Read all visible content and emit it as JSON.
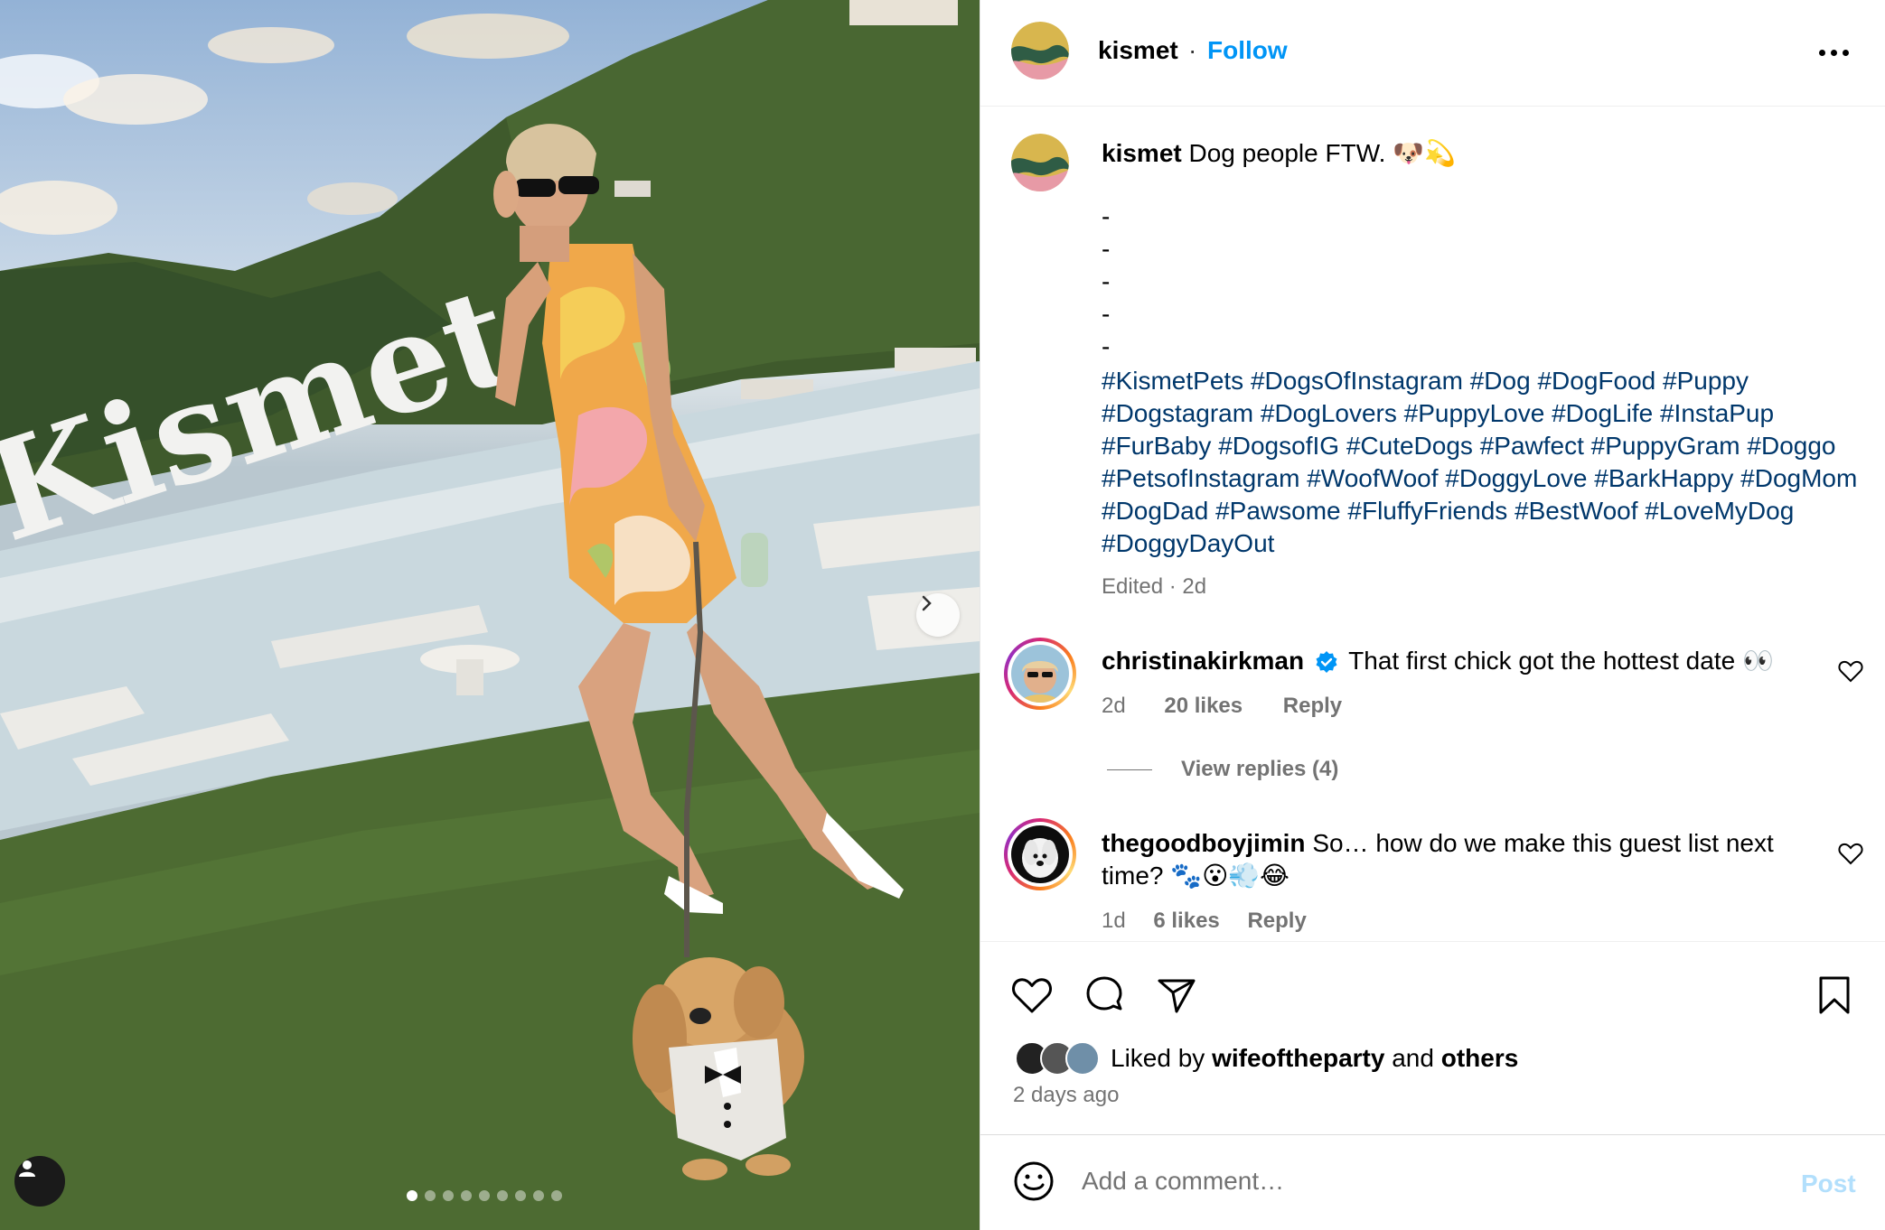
{
  "post": {
    "author": "kismet",
    "follow_label": "Follow",
    "separator": "·",
    "image_sign_text": "Kismet",
    "carousel": {
      "total": 9,
      "active": 1
    }
  },
  "caption": {
    "username": "kismet",
    "text": "Dog people FTW. 🐶💫",
    "dashes": [
      "-",
      "-",
      "-",
      "-",
      "-"
    ],
    "hashtags": [
      "#KismetPets",
      "#DogsOfInstagram",
      "#Dog",
      "#DogFood",
      "#Puppy",
      "#Dogstagram",
      "#DogLovers",
      "#PuppyLove",
      "#DogLife",
      "#InstaPup",
      "#FurBaby",
      "#DogsofIG",
      "#CuteDogs",
      "#Pawfect",
      "#PuppyGram",
      "#Doggo",
      "#PetsofInstagram",
      "#WoofWoof",
      "#DoggyLove",
      "#BarkHappy",
      "#DogMom",
      "#DogDad",
      "#Pawsome",
      "#FluffyFriends",
      "#BestWoof",
      "#LoveMyDog",
      "#DoggyDayOut"
    ],
    "edited_meta": "Edited · 2d"
  },
  "comments": [
    {
      "username": "christinakirkman",
      "verified": true,
      "text": "That first chick got the hottest date 👀",
      "time": "2d",
      "likes": "20 likes",
      "reply_label": "Reply",
      "view_replies": "View replies (4)"
    },
    {
      "username": "thegoodboyjimin",
      "verified": false,
      "text": "So… how do we make this guest list next time? 🐾😮💨😂",
      "time": "1d",
      "likes": "6 likes",
      "reply_label": "Reply"
    }
  ],
  "likes": {
    "prefix": "Liked by",
    "user": "wifeoftheparty",
    "conjunction": "and",
    "others": "others",
    "time_ago": "2 days ago"
  },
  "add_comment": {
    "placeholder": "Add a comment…",
    "post_label": "Post"
  },
  "colors": {
    "link_blue": "#0095f6",
    "hashtag": "#00376b",
    "muted": "#737373",
    "post_disabled": "#b2dffc"
  }
}
